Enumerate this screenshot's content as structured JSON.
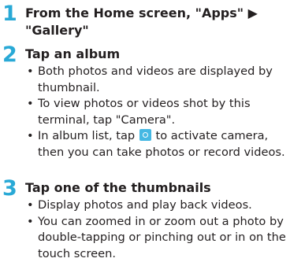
{
  "steps": [
    {
      "num": "1",
      "title_line1": "From the Home screen, \"Apps\" ▶",
      "title_line2": "\"Gallery\""
    },
    {
      "num": "2",
      "title": "Tap an album",
      "bullets": [
        "Both photos and videos are displayed by thumbnail.",
        "To view photos or videos shot by this terminal, tap \"Camera\".",
        {
          "before": "In album list, tap",
          "icon": "camera-icon",
          "after": "to activate camera, then you can take photos or record videos."
        }
      ]
    },
    {
      "num": "3",
      "title": "Tap one of the thumbnails",
      "bullets": [
        "Display photos and play back videos.",
        "You can zoomed in or zoom out a photo by double-tapping or pinching out or in on the touch screen."
      ]
    }
  ],
  "accent_color": "#29a9d6",
  "icon_color": "#45b8e3"
}
